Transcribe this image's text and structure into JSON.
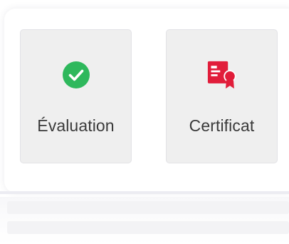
{
  "tiles": [
    {
      "label": "Évaluation",
      "icon": "check-circle-icon",
      "icon_color": "#2eb85c"
    },
    {
      "label": "Certificat",
      "icon": "certificate-icon",
      "icon_color": "#e11d3a"
    }
  ],
  "colors": {
    "tile_background": "#efefef",
    "label_text": "#3a3a3a"
  }
}
